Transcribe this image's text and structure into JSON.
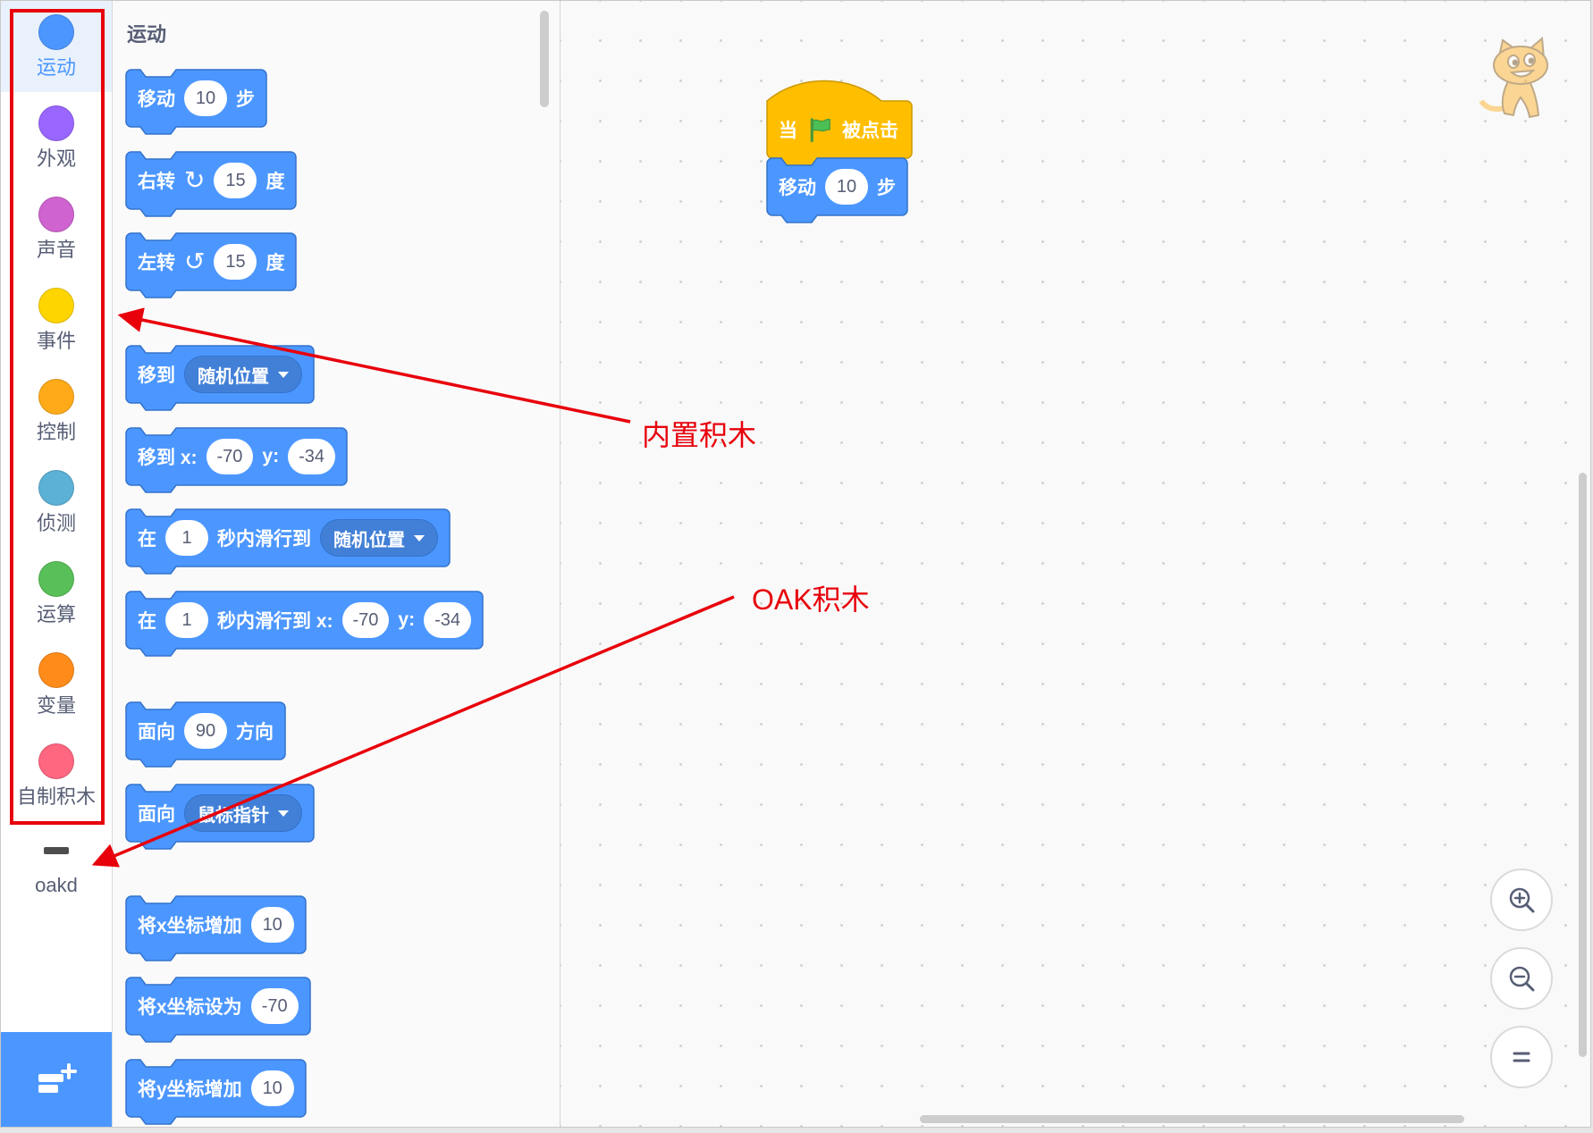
{
  "categories": [
    {
      "label": "运动",
      "color": "#4C97FF"
    },
    {
      "label": "外观",
      "color": "#9966FF"
    },
    {
      "label": "声音",
      "color": "#CF63CF"
    },
    {
      "label": "事件",
      "color": "#FFD500"
    },
    {
      "label": "控制",
      "color": "#FFAB19"
    },
    {
      "label": "侦测",
      "color": "#5CB1D6"
    },
    {
      "label": "运算",
      "color": "#59C059"
    },
    {
      "label": "变量",
      "color": "#FF8C1A"
    },
    {
      "label": "自制积木",
      "color": "#FF6680"
    }
  ],
  "selected_category_index": 0,
  "extension": {
    "label": "oakd",
    "icon": "oakd-device-icon"
  },
  "add_extension_button": {
    "icon": "add-extension-icon",
    "color": "#4C97FF"
  },
  "palette": {
    "title": "运动",
    "block_color": "#4C97FF",
    "block_stroke": "#3373CC",
    "blocks": [
      {
        "parts": [
          {
            "kind": "label",
            "value": "移动"
          },
          {
            "kind": "number",
            "value": "10"
          },
          {
            "kind": "label",
            "value": "步"
          }
        ]
      },
      {
        "parts": [
          {
            "kind": "label",
            "value": "右转"
          },
          {
            "kind": "icon",
            "icon": "rotate-right-icon"
          },
          {
            "kind": "number",
            "value": "15"
          },
          {
            "kind": "label",
            "value": "度"
          }
        ]
      },
      {
        "parts": [
          {
            "kind": "label",
            "value": "左转"
          },
          {
            "kind": "icon",
            "icon": "rotate-left-icon"
          },
          {
            "kind": "number",
            "value": "15"
          },
          {
            "kind": "label",
            "value": "度"
          }
        ]
      },
      {
        "parts": [
          {
            "kind": "label",
            "value": "移到"
          },
          {
            "kind": "dropdown",
            "value": "随机位置"
          }
        ]
      },
      {
        "parts": [
          {
            "kind": "label",
            "value": "移到 x:"
          },
          {
            "kind": "number",
            "value": "-70"
          },
          {
            "kind": "label",
            "value": "y:"
          },
          {
            "kind": "number",
            "value": "-34"
          }
        ]
      },
      {
        "parts": [
          {
            "kind": "label",
            "value": "在"
          },
          {
            "kind": "number",
            "value": "1"
          },
          {
            "kind": "label",
            "value": "秒内滑行到"
          },
          {
            "kind": "dropdown",
            "value": "随机位置"
          }
        ]
      },
      {
        "parts": [
          {
            "kind": "label",
            "value": "在"
          },
          {
            "kind": "number",
            "value": "1"
          },
          {
            "kind": "label",
            "value": "秒内滑行到 x:"
          },
          {
            "kind": "number",
            "value": "-70"
          },
          {
            "kind": "label",
            "value": "y:"
          },
          {
            "kind": "number",
            "value": "-34"
          }
        ]
      },
      {
        "parts": [
          {
            "kind": "label",
            "value": "面向"
          },
          {
            "kind": "number",
            "value": "90"
          },
          {
            "kind": "label",
            "value": "方向"
          }
        ]
      },
      {
        "parts": [
          {
            "kind": "label",
            "value": "面向"
          },
          {
            "kind": "dropdown",
            "value": "鼠标指针"
          }
        ]
      },
      {
        "parts": [
          {
            "kind": "label",
            "value": "将x坐标增加"
          },
          {
            "kind": "number",
            "value": "10"
          }
        ]
      },
      {
        "parts": [
          {
            "kind": "label",
            "value": "将x坐标设为"
          },
          {
            "kind": "number",
            "value": "-70"
          }
        ]
      },
      {
        "parts": [
          {
            "kind": "label",
            "value": "将y坐标增加"
          },
          {
            "kind": "number",
            "value": "10"
          }
        ]
      }
    ]
  },
  "workspace": {
    "sprite_icon": "scratch-cat-icon",
    "script": {
      "hat": {
        "color": "#FFBF00",
        "stroke": "#CC9900",
        "parts": [
          {
            "kind": "label",
            "value": "当"
          },
          {
            "kind": "icon",
            "icon": "green-flag-icon"
          },
          {
            "kind": "label",
            "value": "被点击"
          }
        ]
      },
      "blocks": [
        {
          "parts": [
            {
              "kind": "label",
              "value": "移动"
            },
            {
              "kind": "number",
              "value": "10"
            },
            {
              "kind": "label",
              "value": "步"
            }
          ]
        }
      ]
    },
    "zoom_controls": [
      {
        "icon": "zoom-in-icon"
      },
      {
        "icon": "zoom-out-icon"
      },
      {
        "icon": "zoom-reset-icon"
      }
    ]
  },
  "annotations": {
    "color": "#E8000B",
    "builtin_blocks_label": "内置积木",
    "oak_blocks_label": "OAK积木"
  }
}
